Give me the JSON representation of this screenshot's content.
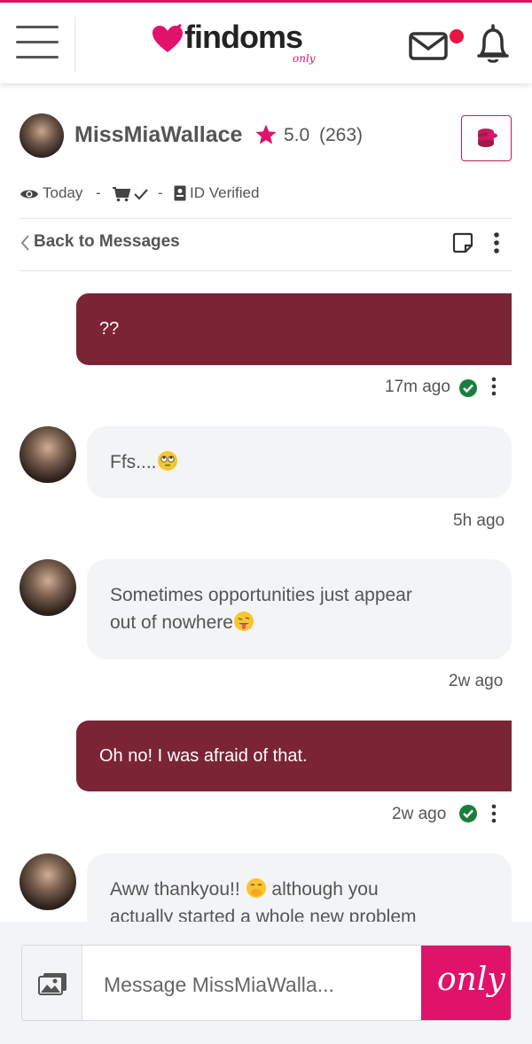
{
  "header": {
    "logo_text": "findoms",
    "logo_sub": "only",
    "brand_color": "#e0126a",
    "has_unread_mail": true
  },
  "profile": {
    "username": "MissMiaWallace",
    "rating": "5.0",
    "rating_count": "(263)",
    "status_today": "Today",
    "separator": "-",
    "id_verified": "ID Verified"
  },
  "conversation": {
    "back_label": "Back to Messages"
  },
  "messages": [
    {
      "direction": "outgoing",
      "text": "??",
      "time": "17m ago",
      "read": true
    },
    {
      "direction": "incoming",
      "text": "Ffs....",
      "emoji": "rolling-eyes",
      "time": "5h ago"
    },
    {
      "direction": "incoming",
      "line1": "Sometimes opportunities just appear",
      "line2": "out of nowhere",
      "emoji": "tongue-out",
      "time": "2w ago"
    },
    {
      "direction": "outgoing",
      "text": "Oh no! I was afraid of that.",
      "time": "2w ago",
      "read": true
    },
    {
      "direction": "incoming",
      "line1": "Aww thankyou!!",
      "line1b": "although you",
      "line2": "actually started a whole new problem",
      "emoji": "hand-over-mouth"
    }
  ],
  "composer": {
    "placeholder": "Message MissMiaWalla...",
    "send_label": "only"
  },
  "colors": {
    "outgoing_bubble": "#7b2435",
    "incoming_bubble": "#f3f4f6",
    "verified_check": "#1a7f3c"
  }
}
